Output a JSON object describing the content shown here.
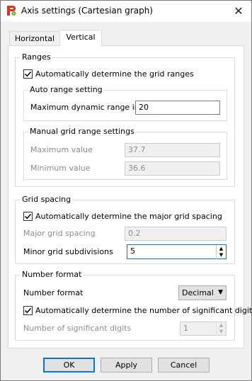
{
  "window": {
    "title": "Axis settings (Cartesian graph)",
    "close_glyph": "✕",
    "icon": "app-logo-icon"
  },
  "tabs": [
    {
      "label": "Horizontal",
      "active": false
    },
    {
      "label": "Vertical",
      "active": true
    }
  ],
  "ranges": {
    "legend": "Ranges",
    "auto_checkbox": {
      "label": "Automatically determine the grid ranges",
      "checked": true
    },
    "auto_range": {
      "legend": "Auto range setting",
      "max_dynamic_label": "Maximum dynamic range in dB",
      "max_dynamic_value": "20"
    },
    "manual": {
      "legend": "Manual grid range settings",
      "max_label": "Maximum value",
      "max_value": "37.7",
      "min_label": "Minimum value",
      "min_value": "36.6"
    }
  },
  "grid_spacing": {
    "legend": "Grid spacing",
    "auto_checkbox": {
      "label": "Automatically determine the major grid spacing",
      "checked": true
    },
    "major_label": "Major grid spacing",
    "major_value": "0.2",
    "minor_label": "Minor grid subdivisions",
    "minor_value": "5"
  },
  "number_format": {
    "legend": "Number format",
    "format_label": "Number format",
    "format_value": "Decimal",
    "auto_checkbox": {
      "label": "Automatically determine the number of significant digits",
      "checked": true
    },
    "sig_digits_label": "Number of significant digits",
    "sig_digits_value": "1"
  },
  "buttons": {
    "ok": "OK",
    "apply": "Apply",
    "cancel": "Cancel"
  },
  "colors": {
    "accent": "#0078d7",
    "disabled_text": "#8c8c8c",
    "panel": "#ffffff",
    "window": "#f0f0f0"
  }
}
